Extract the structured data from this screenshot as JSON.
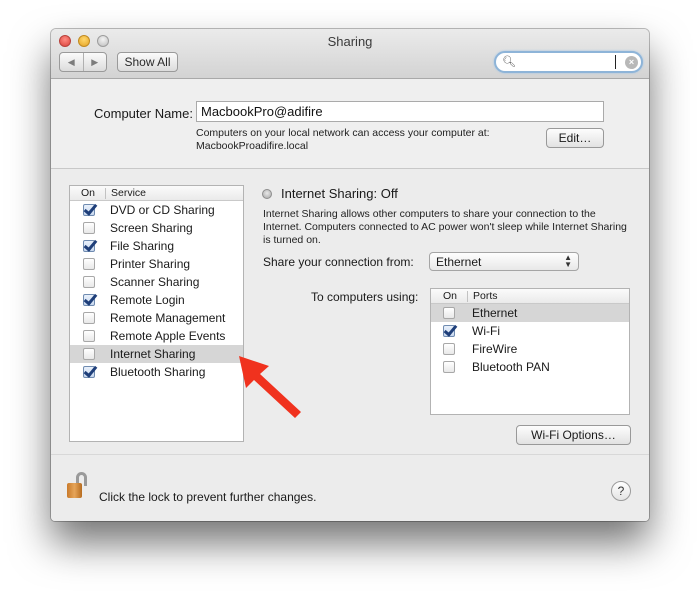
{
  "window": {
    "title": "Sharing",
    "show_all_label": "Show All",
    "search": {
      "value": "",
      "placeholder": ""
    }
  },
  "computer_name": {
    "label": "Computer Name:",
    "value": "MacbookPro@adifire",
    "help_line1": "Computers on your local network can access your computer at:",
    "help_line2": "MacbookProadifire.local",
    "edit_label": "Edit…"
  },
  "services": {
    "header_on": "On",
    "header_service": "Service",
    "items": [
      {
        "label": "DVD or CD Sharing",
        "on": true
      },
      {
        "label": "Screen Sharing",
        "on": false
      },
      {
        "label": "File Sharing",
        "on": true
      },
      {
        "label": "Printer Sharing",
        "on": false
      },
      {
        "label": "Scanner Sharing",
        "on": false
      },
      {
        "label": "Remote Login",
        "on": true
      },
      {
        "label": "Remote Management",
        "on": false
      },
      {
        "label": "Remote Apple Events",
        "on": false
      },
      {
        "label": "Internet Sharing",
        "on": false,
        "selected": true
      },
      {
        "label": "Bluetooth Sharing",
        "on": true
      }
    ]
  },
  "detail": {
    "status_title": "Internet Sharing: Off",
    "description": "Internet Sharing allows other computers to share your connection to the Internet. Computers connected to AC power won't sleep while Internet Sharing is turned on.",
    "share_from_label": "Share your connection from:",
    "share_from_value": "Ethernet",
    "to_computers_label": "To computers using:",
    "ports_header_on": "On",
    "ports_header_name": "Ports",
    "ports": [
      {
        "label": "Ethernet",
        "on": false,
        "selected": true
      },
      {
        "label": "Wi-Fi",
        "on": true
      },
      {
        "label": "FireWire",
        "on": false
      },
      {
        "label": "Bluetooth PAN",
        "on": false
      }
    ],
    "wifi_options_label": "Wi-Fi Options…"
  },
  "footer": {
    "lock_text": "Click the lock to prevent further changes.",
    "help_label": "?"
  },
  "annotation": {
    "arrow_color": "#f0321e"
  }
}
